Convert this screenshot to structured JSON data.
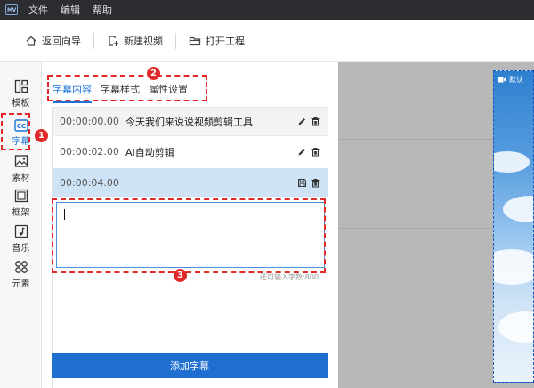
{
  "app": {
    "logo_text": "MV",
    "menu": [
      "文件",
      "编辑",
      "帮助"
    ]
  },
  "toolbar": {
    "back_label": "返回向导",
    "new_video_label": "新建视频",
    "open_project_label": "打开工程"
  },
  "leftnav": {
    "items": [
      {
        "label": "模板",
        "icon": "template-icon"
      },
      {
        "label": "字幕",
        "icon": "subtitle-cc-icon",
        "active": true
      },
      {
        "label": "素材",
        "icon": "image-icon"
      },
      {
        "label": "框架",
        "icon": "frame-icon"
      },
      {
        "label": "音乐",
        "icon": "music-icon"
      },
      {
        "label": "元素",
        "icon": "elements-icon"
      }
    ]
  },
  "panel": {
    "tabs": [
      "字幕内容",
      "字幕样式",
      "属性设置"
    ],
    "active_tab": 0,
    "rows": [
      {
        "time": "00:00:00.00",
        "text": "今天我们来说说视频剪辑工具"
      },
      {
        "time": "00:00:02.00",
        "text": "AI自动剪辑"
      },
      {
        "time": "00:00:04.00",
        "text": ""
      }
    ],
    "editor_value": "",
    "char_count": "还可输入字数:800",
    "add_button": "添加字幕"
  },
  "preview": {
    "canvas_label": "默认"
  },
  "annotations": [
    "1",
    "2",
    "3"
  ],
  "colors": {
    "accent": "#1a73d9",
    "annotation": "#e02a2a",
    "menubar": "#2b2d31",
    "selected_row": "#cfe3f7",
    "add_button": "#1f6fd1"
  }
}
